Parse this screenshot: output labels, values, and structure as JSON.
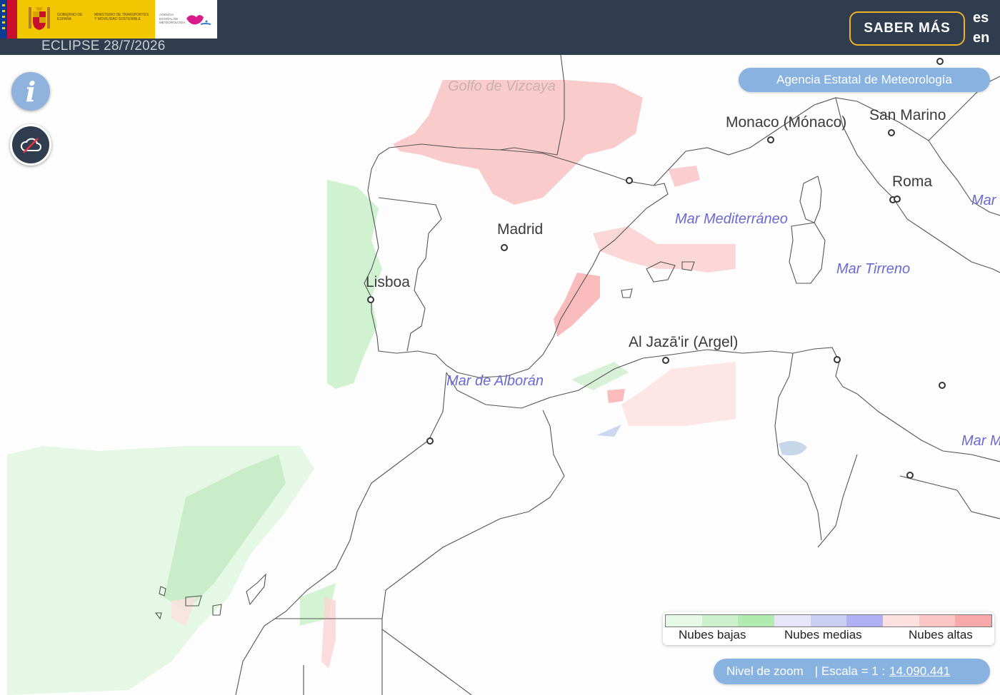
{
  "header": {
    "title": "ECLIPSE 28/7/2026",
    "saber_mas_label": "SABER MÁS",
    "lang_es": "es",
    "lang_en": "en",
    "logo": {
      "left_text": "GOBIERNO DE ESPAÑA",
      "right_text": "MINISTERIO DE TRANSPORTES Y MOVILIDAD SOSTENIBLE",
      "agency_text": "AGENCIA ESTATAL DE METEOROLOGÍA"
    }
  },
  "map": {
    "agency_link": "Agencia Estatal de Meteorología",
    "places": {
      "madrid": "Madrid",
      "lisboa": "Lisboa",
      "monaco": "Monaco (Mónaco)",
      "san_marino": "San Marino",
      "roma": "Roma",
      "argel": "Al Jazā'ir (Argel)"
    },
    "seas": {
      "vizcaya": "Golfo de Vizcaya",
      "mediterraneo": "Mar Mediterráneo",
      "tirreno": "Mar Tirreno",
      "alboran": "Mar de Alborán",
      "mar_right_top": "Mar",
      "mar_right_bottom": "Mar M"
    }
  },
  "controls": {
    "info_icon": "info-icon",
    "cloud_toggle_icon": "cloud-off-icon"
  },
  "legend": {
    "colors": [
      "#e6f8e6",
      "#ccf1cc",
      "#b0ecb0",
      "#e6e6f8",
      "#cccff4",
      "#b0b0f4",
      "#fde0e0",
      "#fbc5c5",
      "#f8a8a8"
    ],
    "labels": {
      "low": "Nubes bajas",
      "mid": "Nubes medias",
      "high": "Nubes altas"
    }
  },
  "scale": {
    "zoom_label": "Nivel de zoom",
    "scale_prefix": "| Escala = 1 :",
    "scale_value": "14.090.441"
  }
}
